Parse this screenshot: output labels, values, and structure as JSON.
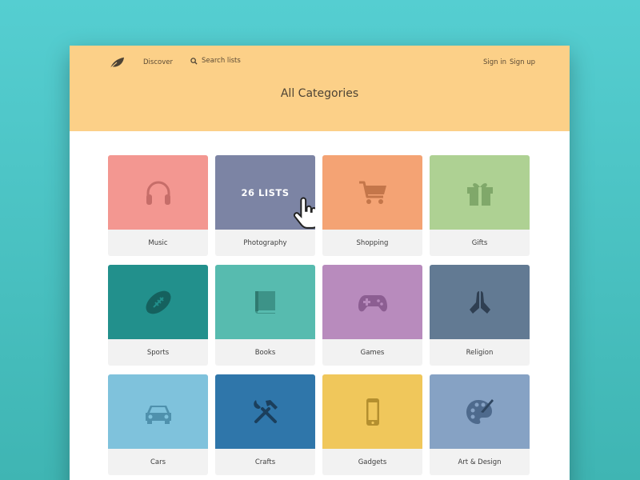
{
  "nav": {
    "discover": "Discover",
    "search_placeholder": "Search lists",
    "sign_in": "Sign in",
    "sign_up": "Sign up"
  },
  "page": {
    "title": "All Categories"
  },
  "categories": [
    {
      "label": "Music",
      "icon": "headphones-icon",
      "color": "#f39791"
    },
    {
      "label": "Photography",
      "icon": "camera-icon",
      "color": "#7c84a4",
      "hover": "26 LISTS"
    },
    {
      "label": "Shopping",
      "icon": "shopping-cart-icon",
      "color": "#f4a374"
    },
    {
      "label": "Gifts",
      "icon": "gift-icon",
      "color": "#aed193"
    },
    {
      "label": "Sports",
      "icon": "football-icon",
      "color": "#22908c"
    },
    {
      "label": "Books",
      "icon": "book-icon",
      "color": "#57bbaf"
    },
    {
      "label": "Games",
      "icon": "gamepad-icon",
      "color": "#b88bbd"
    },
    {
      "label": "Religion",
      "icon": "praying-hands-icon",
      "color": "#627a93"
    },
    {
      "label": "Cars",
      "icon": "car-icon",
      "color": "#7fc2dc"
    },
    {
      "label": "Crafts",
      "icon": "tools-icon",
      "color": "#2f76aa"
    },
    {
      "label": "Gadgets",
      "icon": "smartphone-icon",
      "color": "#f0c75b"
    },
    {
      "label": "Art & Design",
      "icon": "palette-icon",
      "color": "#86a2c4"
    }
  ]
}
